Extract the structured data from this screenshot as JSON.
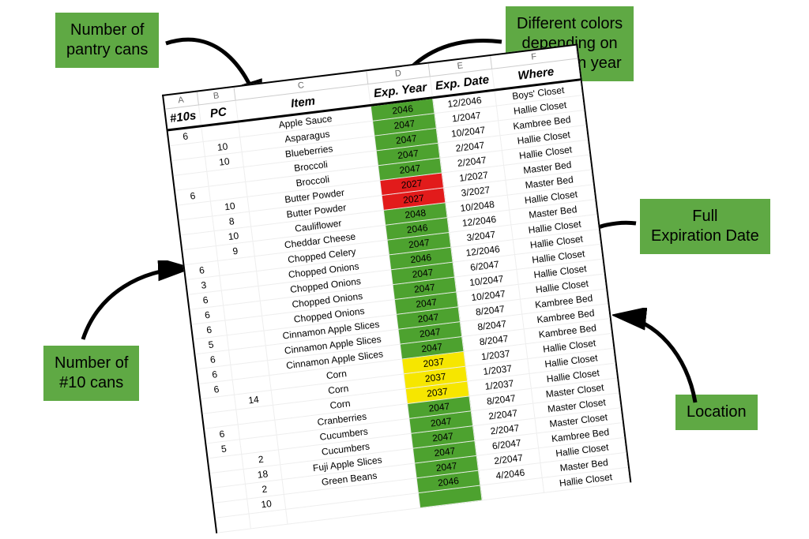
{
  "callouts": {
    "pantry": "Number of\npantry cans",
    "colors": "Different colors\ndepending on\nexpiration year",
    "fullexp": "Full\nExpiration Date",
    "tens": "Number of\n#10 cans",
    "location": "Location"
  },
  "col_letters": [
    "A",
    "B",
    "C",
    "D",
    "E",
    "F"
  ],
  "headers": {
    "a": "#10s",
    "b": "PC",
    "c": "Item",
    "d": "Exp. Year",
    "e": "Exp. Date",
    "f": "Where"
  },
  "rows": [
    {
      "a": "6",
      "b": "",
      "c": "Apple Sauce",
      "d": "2046",
      "dcls": "gY",
      "e": "12/2046",
      "f": "Boys' Closet"
    },
    {
      "a": "",
      "b": "10",
      "c": "Asparagus",
      "d": "2047",
      "dcls": "gY",
      "e": "1/2047",
      "f": "Hallie Closet"
    },
    {
      "a": "",
      "b": "10",
      "c": "Blueberries",
      "d": "2047",
      "dcls": "gY",
      "e": "10/2047",
      "f": "Kambree Bed"
    },
    {
      "a": "",
      "b": "",
      "c": "Broccoli",
      "d": "2047",
      "dcls": "gY",
      "e": "2/2047",
      "f": "Hallie Closet"
    },
    {
      "a": "6",
      "b": "",
      "c": "Broccoli",
      "d": "2047",
      "dcls": "gY",
      "e": "2/2047",
      "f": "Hallie Closet"
    },
    {
      "a": "",
      "b": "10",
      "c": "Butter Powder",
      "d": "2027",
      "dcls": "rY",
      "e": "1/2027",
      "f": "Master Bed"
    },
    {
      "a": "",
      "b": "8",
      "c": "Butter Powder",
      "d": "2027",
      "dcls": "rY",
      "e": "3/2027",
      "f": "Master Bed"
    },
    {
      "a": "",
      "b": "10",
      "c": "Cauliflower",
      "d": "2048",
      "dcls": "gY",
      "e": "10/2048",
      "f": "Hallie Closet"
    },
    {
      "a": "",
      "b": "9",
      "c": "Cheddar Cheese",
      "d": "2046",
      "dcls": "gY",
      "e": "12/2046",
      "f": "Master Bed"
    },
    {
      "a": "6",
      "b": "",
      "c": "Chopped Celery",
      "d": "2047",
      "dcls": "gY",
      "e": "3/2047",
      "f": "Hallie Closet"
    },
    {
      "a": "3",
      "b": "",
      "c": "Chopped Onions",
      "d": "2046",
      "dcls": "gY",
      "e": "12/2046",
      "f": "Hallie Closet"
    },
    {
      "a": "6",
      "b": "",
      "c": "Chopped Onions",
      "d": "2047",
      "dcls": "gY",
      "e": "6/2047",
      "f": "Hallie Closet"
    },
    {
      "a": "6",
      "b": "",
      "c": "Chopped Onions",
      "d": "2047",
      "dcls": "gY",
      "e": "10/2047",
      "f": "Hallie Closet"
    },
    {
      "a": "6",
      "b": "",
      "c": "Chopped Onions",
      "d": "2047",
      "dcls": "gY",
      "e": "10/2047",
      "f": "Hallie Closet"
    },
    {
      "a": "5",
      "b": "",
      "c": "Cinnamon Apple Slices",
      "d": "2047",
      "dcls": "gY",
      "e": "8/2047",
      "f": "Kambree Bed"
    },
    {
      "a": "6",
      "b": "",
      "c": "Cinnamon Apple Slices",
      "d": "2047",
      "dcls": "gY",
      "e": "8/2047",
      "f": "Kambree Bed"
    },
    {
      "a": "6",
      "b": "",
      "c": "Cinnamon Apple Slices",
      "d": "2047",
      "dcls": "gY",
      "e": "8/2047",
      "f": "Kambree Bed"
    },
    {
      "a": "6",
      "b": "",
      "c": "Corn",
      "d": "2037",
      "dcls": "yY",
      "e": "1/2037",
      "f": "Hallie Closet"
    },
    {
      "a": "",
      "b": "14",
      "c": "Corn",
      "d": "2037",
      "dcls": "yY",
      "e": "1/2037",
      "f": "Hallie Closet"
    },
    {
      "a": "",
      "b": "",
      "c": "Corn",
      "d": "2037",
      "dcls": "yY",
      "e": "1/2037",
      "f": "Hallie Closet"
    },
    {
      "a": "6",
      "b": "",
      "c": "Cranberries",
      "d": "2047",
      "dcls": "gY",
      "e": "8/2047",
      "f": "Master Closet"
    },
    {
      "a": "5",
      "b": "",
      "c": "Cucumbers",
      "d": "2047",
      "dcls": "gY",
      "e": "2/2047",
      "f": "Master Closet"
    },
    {
      "a": "",
      "b": "2",
      "c": "Cucumbers",
      "d": "2047",
      "dcls": "gY",
      "e": "2/2047",
      "f": "Master Closet"
    },
    {
      "a": "",
      "b": "18",
      "c": "Fuji Apple Slices",
      "d": "2047",
      "dcls": "gY",
      "e": "6/2047",
      "f": "Kambree Bed"
    },
    {
      "a": "",
      "b": "2",
      "c": "Green Beans",
      "d": "2047",
      "dcls": "gY",
      "e": "2/2047",
      "f": "Hallie Closet"
    },
    {
      "a": "",
      "b": "10",
      "c": "",
      "d": "2046",
      "dcls": "gY",
      "e": "4/2046",
      "f": "Master Bed"
    },
    {
      "a": "",
      "b": "",
      "c": "",
      "d": "",
      "dcls": "gY",
      "e": "",
      "f": "Hallie Closet"
    }
  ]
}
